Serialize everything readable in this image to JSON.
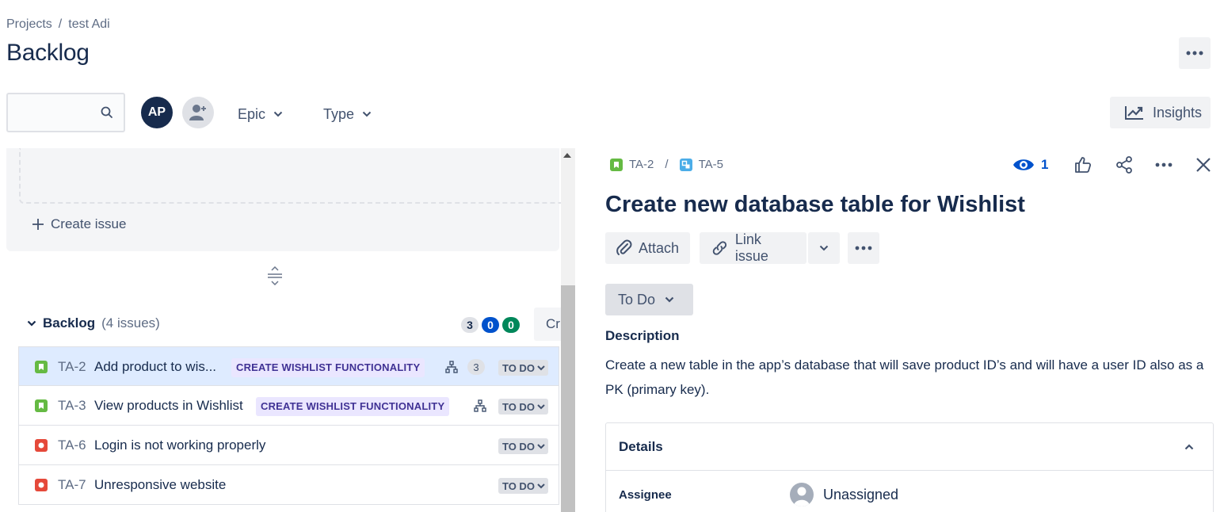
{
  "breadcrumb": {
    "projects": "Projects",
    "separator": "/",
    "project": "test Adi"
  },
  "page_title": "Backlog",
  "toolbar": {
    "search_placeholder": "",
    "avatar_initials": "AP",
    "epic_label": "Epic",
    "type_label": "Type",
    "insights_label": "Insights"
  },
  "sprint": {
    "create_issue_label": "Create issue"
  },
  "backlog": {
    "label": "Backlog",
    "count_label": "(4 issues)",
    "badges": [
      {
        "value": "3",
        "color": "#dfe1e6"
      },
      {
        "value": "0",
        "color": "#0052cc"
      },
      {
        "value": "0",
        "color": "#00875a"
      }
    ],
    "create_sprint_label": "Cr",
    "issues": [
      {
        "key": "TA-2",
        "summary": "Add product to wis...",
        "type": "story",
        "epic": "CREATE WISHLIST FUNCTIONALITY",
        "children": "3",
        "status": "TO DO",
        "selected": true
      },
      {
        "key": "TA-3",
        "summary": "View products in Wishlist",
        "type": "story",
        "epic": "CREATE WISHLIST FUNCTIONALITY",
        "children": "",
        "status": "TO DO",
        "selected": false
      },
      {
        "key": "TA-6",
        "summary": "Login is not working properly",
        "type": "bug",
        "epic": "",
        "children": "",
        "status": "TO DO",
        "selected": false
      },
      {
        "key": "TA-7",
        "summary": "Unresponsive website",
        "type": "bug",
        "epic": "",
        "children": "",
        "status": "TO DO",
        "selected": false
      }
    ]
  },
  "detail": {
    "parent_key": "TA-2",
    "separator": "/",
    "issue_key": "TA-5",
    "watch_count": "1",
    "title": "Create new database table for Wishlist",
    "attach_label": "Attach",
    "link_issue_label": "Link issue",
    "status_label": "To Do",
    "description_label": "Description",
    "description_text": "Create a new table in the app’s database that will save product ID’s and will have a user ID also as a PK (primary key).",
    "details_label": "Details",
    "assignee_label": "Assignee",
    "assignee_value": "Unassigned"
  },
  "colors": {
    "story": "#65ba43",
    "bug": "#e5493a",
    "subtask": "#4bade8",
    "epic_bg": "#eae6ff",
    "epic_text": "#403294",
    "selected_row": "#deebff"
  }
}
